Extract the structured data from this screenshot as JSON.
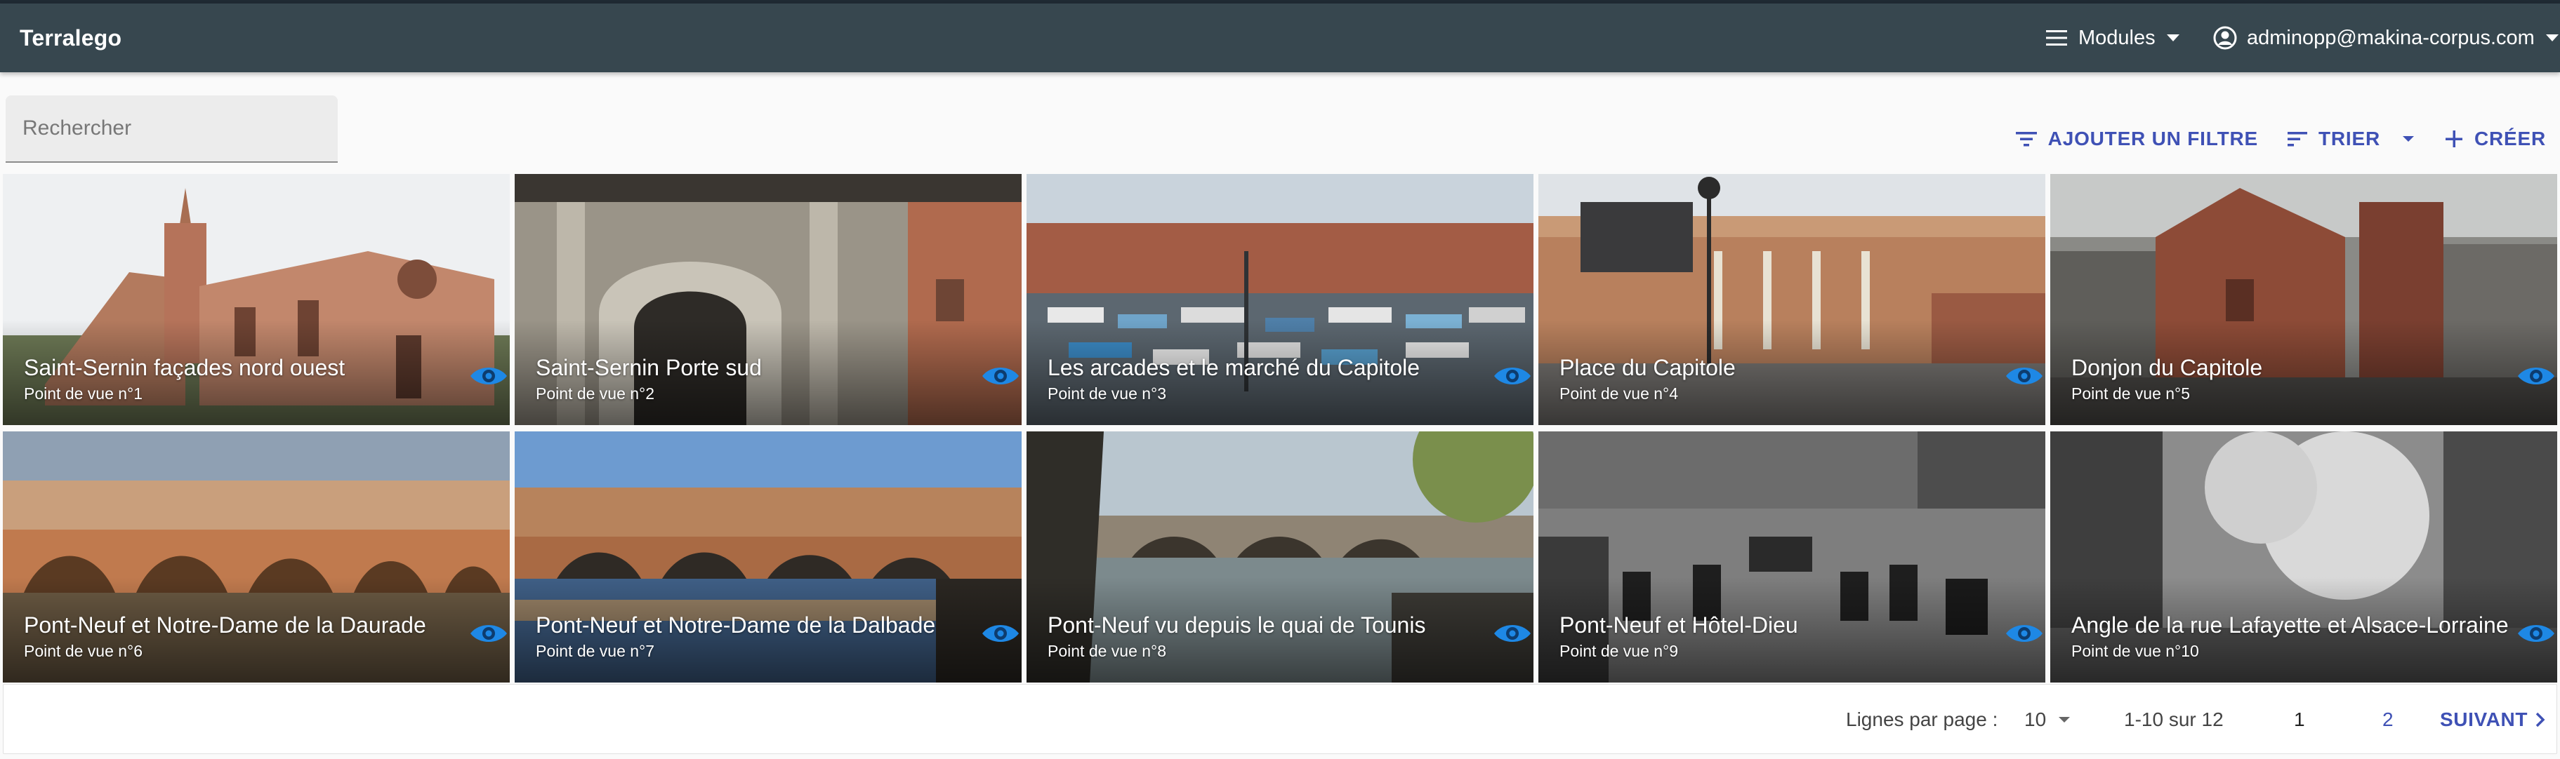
{
  "appbar": {
    "brand": "Terralego",
    "modules_label": "Modules",
    "user_email": "adminopp@makina-corpus.com"
  },
  "search": {
    "placeholder": "Rechercher"
  },
  "toolbar": {
    "add_filter_label": "AJOUTER UN FILTRE",
    "sort_label": "TRIER",
    "create_label": "CRÉER"
  },
  "cards": [
    {
      "title": "Saint-Sernin façades nord ouest",
      "subtitle": "Point de vue n°1"
    },
    {
      "title": "Saint-Sernin Porte sud",
      "subtitle": "Point de vue n°2"
    },
    {
      "title": "Les arcades et le marché du Capitole",
      "subtitle": "Point de vue n°3"
    },
    {
      "title": "Place du Capitole",
      "subtitle": "Point de vue n°4"
    },
    {
      "title": "Donjon du Capitole",
      "subtitle": "Point de vue n°5"
    },
    {
      "title": "Pont-Neuf et Notre-Dame de la Daurade",
      "subtitle": "Point de vue n°6"
    },
    {
      "title": "Pont-Neuf et Notre-Dame de la Dalbade",
      "subtitle": "Point de vue n°7"
    },
    {
      "title": "Pont-Neuf vu depuis le quai de Tounis",
      "subtitle": "Point de vue n°8"
    },
    {
      "title": "Pont-Neuf et Hôtel-Dieu",
      "subtitle": "Point de vue n°9"
    },
    {
      "title": "Angle de la rue Lafayette et Alsace-Lorraine",
      "subtitle": "Point de vue n°10"
    }
  ],
  "pagination": {
    "rows_label": "Lignes par page :",
    "rows_value": "10",
    "range": "1-10 sur 12",
    "page_current": "1",
    "page_next": "2",
    "next_label": "SUIVANT"
  },
  "colors": {
    "appbar": "#37474f",
    "accent": "#3f51b5",
    "eye_icon": "#1e88e5"
  },
  "icons": {
    "menu": "menu-icon",
    "dropdown": "arrow-drop-down-icon",
    "user": "account-circle-icon",
    "filter": "filter-icon",
    "sort": "sort-icon",
    "add": "plus-icon",
    "view": "eye-icon",
    "next": "chevron-right-icon"
  }
}
